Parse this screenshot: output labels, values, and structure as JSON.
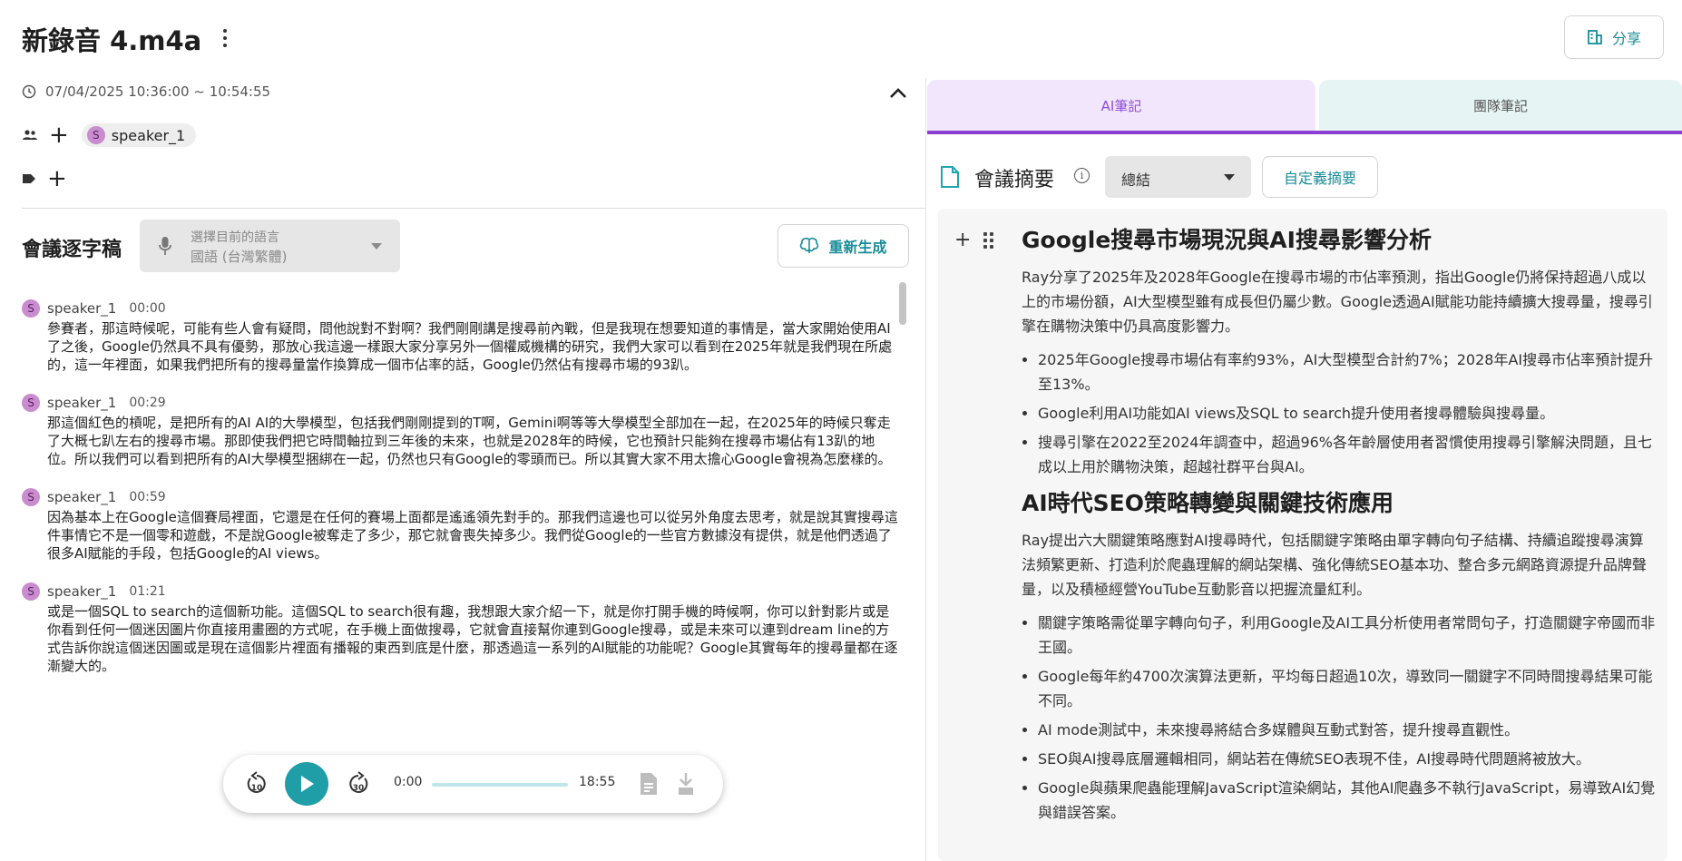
{
  "header": {
    "title": "新錄音 4.m4a",
    "share_label": "分享"
  },
  "meta": {
    "time_range": "07/04/2025 10:36:00 ~ 10:54:55",
    "speaker_chip": "speaker_1",
    "avatar_letter": "S"
  },
  "transcript": {
    "title": "會議逐字稿",
    "lang_label": "選擇目前的語言",
    "lang_value": "國語 (台灣繁體)",
    "regen_label": "重新生成",
    "segments": [
      {
        "speaker": "speaker_1",
        "time": "00:00",
        "text": "參賽者，那這時候呢，可能有些人會有疑問，問他說對不對啊？我們剛剛講是搜尋前內戰，但是我現在想要知道的事情是，當大家開始使用AI了之後，Google仍然具不具有優勢，那放心我這邊一樣跟大家分享另外一個權威機構的研究，我們大家可以看到在2025年就是我們現在所處的，這一年裡面，如果我們把所有的搜尋量當作換算成一個市佔率的話，Google仍然佔有搜尋市場的93趴。"
      },
      {
        "speaker": "speaker_1",
        "time": "00:29",
        "text": "那這個紅色的槓呢，是把所有的AI AI的大學模型，包括我們剛剛提到的T啊，Gemini啊等等大學模型全部加在一起，在2025年的時候只奪走了大概七趴左右的搜尋市場。那即使我們把它時間軸拉到三年後的未來，也就是2028年的時候，它也預計只能夠在搜尋市場佔有13趴的地位。所以我們可以看到把所有的AI大學模型捆綁在一起，仍然也只有Google的零頭而已。所以其實大家不用太擔心Google會視為怎麼樣的。"
      },
      {
        "speaker": "speaker_1",
        "time": "00:59",
        "text": "因為基本上在Google這個賽局裡面，它還是在任何的賽場上面都是遙遙領先對手的。那我們這邊也可以從另外角度去思考，就是說其實搜尋這件事情它不是一個零和遊戲，不是說Google被奪走了多少，那它就會喪失掉多少。我們從Google的一些官方數據沒有提供，就是他們透過了很多AI賦能的手段，包括Google的AI views。"
      },
      {
        "speaker": "speaker_1",
        "time": "01:21",
        "text": "或是一個SQL to search的這個新功能。這個SQL to search很有趣，我想跟大家介紹一下，就是你打開手機的時候啊，你可以針對影片或是你看到任何一個迷因圖片你直接用畫圈的方式呢，在手機上面做搜尋，它就會直接幫你連到Google搜尋，或是未來可以連到dream line的方式告訴你說這個迷因圖或是現在這個影片裡面有播報的東西到底是什麼，那透過這一系列的AI賦能的功能呢？Google其實每年的搜尋量都在逐漸變大的。"
      }
    ]
  },
  "player": {
    "current": "0:00",
    "duration": "18:55",
    "progress": 0,
    "rewind_label": "10",
    "forward_label": "30"
  },
  "tabs": {
    "ai": "AI筆記",
    "team": "團隊筆記"
  },
  "summary": {
    "title": "會議摘要",
    "select_value": "總結",
    "custom_label": "自定義摘要",
    "sections": [
      {
        "heading": "Google搜尋市場現況與AI搜尋影響分析",
        "paragraph": "Ray分享了2025年及2028年Google在搜尋市場的市佔率預測，指出Google仍將保持超過八成以上的市場份額，AI大型模型雖有成長但仍屬少數。Google透過AI賦能功能持續擴大搜尋量，搜尋引擎在購物決策中仍具高度影響力。",
        "bullets": [
          "2025年Google搜尋市場佔有率約93%，AI大型模型合計約7%；2028年AI搜尋市佔率預計提升至13%。",
          "Google利用AI功能如AI views及SQL to search提升使用者搜尋體驗與搜尋量。",
          "搜尋引擎在2022至2024年調查中，超過96%各年齡層使用者習慣使用搜尋引擎解決問題，且七成以上用於購物決策，超越社群平台與AI。"
        ]
      },
      {
        "heading": "AI時代SEO策略轉變與關鍵技術應用",
        "paragraph": "Ray提出六大關鍵策略應對AI搜尋時代，包括關鍵字策略由單字轉向句子結構、持續追蹤搜尋演算法頻繁更新、打造利於爬蟲理解的網站架構、強化傳統SEO基本功、整合多元網路資源提升品牌聲量，以及積極經營YouTube互動影音以把握流量紅利。",
        "bullets": [
          "關鍵字策略需從單字轉向句子，利用Google及AI工具分析使用者常問句子，打造關鍵字帝國而非王國。",
          "Google每年約4700次演算法更新，平均每日超過10次，導致同一關鍵字不同時間搜尋結果可能不同。",
          "AI mode測試中，未來搜尋將結合多媒體與互動式對答，提升搜尋直觀性。",
          "SEO與AI搜尋底層邏輯相同，網站若在傳統SEO表現不佳，AI搜尋時代問題將被放大。",
          "Google與蘋果爬蟲能理解JavaScript渲染網站，其他AI爬蟲多不執行JavaScript，易導致AI幻覺與錯誤答案。"
        ]
      }
    ]
  }
}
